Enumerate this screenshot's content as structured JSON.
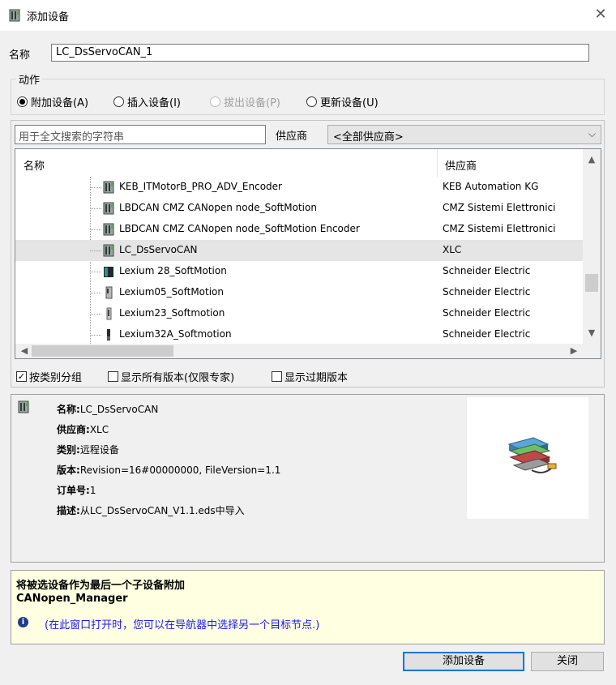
{
  "window": {
    "title": "添加设备",
    "close_glyph": "✕",
    "icon": "device-icon"
  },
  "name_field": {
    "label": "名称",
    "value": "LC_DsServoCAN_1"
  },
  "action": {
    "title": "动作",
    "options": [
      {
        "label": "附加设备(A)",
        "selected": true,
        "disabled": false
      },
      {
        "label": "插入设备(I)",
        "selected": false,
        "disabled": false
      },
      {
        "label": "拔出设备(P)",
        "selected": false,
        "disabled": true
      },
      {
        "label": "更新设备(U)",
        "selected": false,
        "disabled": false
      }
    ]
  },
  "search": {
    "placeholder": "用于全文搜索的字符串",
    "vendor_label": "供应商",
    "vendor_value": "<全部供应商>"
  },
  "table": {
    "col_name": "名称",
    "col_vendor": "供应商",
    "rows": [
      {
        "name": "KEB_ITMotorB_PRO_ADV_Encoder",
        "vendor": "KEB Automation KG",
        "icon": "device-icon",
        "selected": false
      },
      {
        "name": "LBDCAN CMZ CANopen node_SoftMotion",
        "vendor": "CMZ Sistemi Elettronici",
        "icon": "device-icon",
        "selected": false
      },
      {
        "name": "LBDCAN CMZ CANopen node_SoftMotion Encoder",
        "vendor": "CMZ Sistemi Elettronici",
        "icon": "device-icon",
        "selected": false
      },
      {
        "name": "LC_DsServoCAN",
        "vendor": "XLC",
        "icon": "device-icon",
        "selected": true
      },
      {
        "name": "Lexium 28_SoftMotion",
        "vendor": "Schneider Electric",
        "icon": "servo-drive-icon",
        "selected": false
      },
      {
        "name": "Lexium05_SoftMotion",
        "vendor": "Schneider Electric",
        "icon": "servo-drive-icon",
        "selected": false
      },
      {
        "name": "Lexium23_Softmotion",
        "vendor": "Schneider Electric",
        "icon": "servo-drive-icon",
        "selected": false
      },
      {
        "name": "Lexium32A_Softmotion",
        "vendor": "Schneider Electric",
        "icon": "servo-drive-icon",
        "selected": false
      }
    ]
  },
  "options": {
    "group_by_category": {
      "label": "按类别分组",
      "checked": true
    },
    "show_all_versions": {
      "label": "显示所有版本(仅限专家)",
      "checked": false
    },
    "show_outdated": {
      "label": "显示过期版本",
      "checked": false
    }
  },
  "details": {
    "name_label": "名称:",
    "name_value": "LC_DsServoCAN",
    "vendor_label": "供应商:",
    "vendor_value": "XLC",
    "category_label": "类别:",
    "category_value": "远程设备",
    "version_label": "版本:",
    "version_value": "Revision=16#00000000, FileVersion=1.1",
    "order_label": "订单号:",
    "order_value": "1",
    "desc_label": "描述:",
    "desc_value": "从LC_DsServoCAN_V1.1.eds中导入",
    "preview_icon": "network-device-icon"
  },
  "hint": {
    "title": "将被选设备作为最后一个子设备附加",
    "target": "CANopen_Manager",
    "info_glyph": "i",
    "message": "(在此窗口打开时，您可以在导航器中选择另一个目标节点.)"
  },
  "buttons": {
    "add": "添加设备",
    "close": "关闭"
  },
  "scroll": {
    "up": "▲",
    "down": "▼",
    "left": "◀",
    "right": "▶"
  }
}
